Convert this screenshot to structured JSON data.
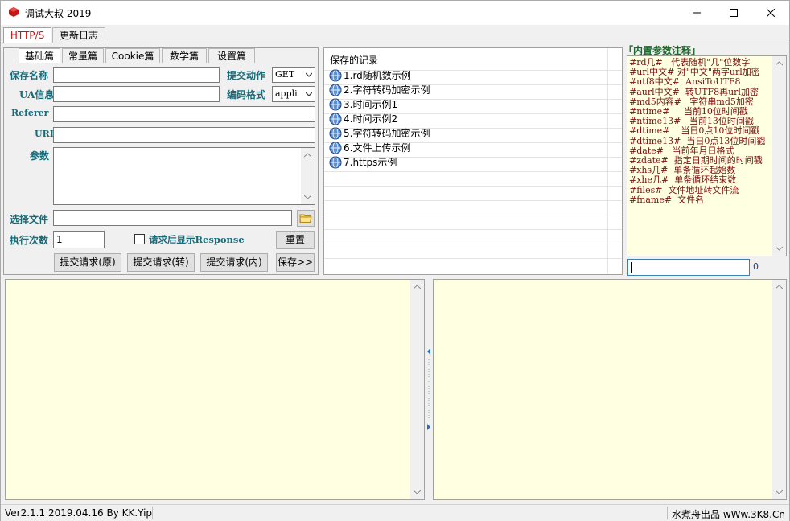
{
  "window": {
    "title": "调试大叔 2019"
  },
  "top_tabs": [
    {
      "label": "HTTP/S"
    },
    {
      "label": "更新日志"
    }
  ],
  "sub_tabs": [
    {
      "label": "基础篇"
    },
    {
      "label": "常量篇"
    },
    {
      "label": "Cookie篇"
    },
    {
      "label": "数学篇"
    },
    {
      "label": "设置篇"
    }
  ],
  "form": {
    "save_name_label": "保存名称",
    "ua_label": "UA信息",
    "referer_label": "Referer",
    "url_label": "URL",
    "params_label": "参数",
    "file_label": "选择文件",
    "count_label": "执行次数",
    "count_value": "1",
    "method_label": "提交动作",
    "method_value": "GET",
    "encoding_label": "编码格式",
    "encoding_value": "appli",
    "show_response_label": "请求后显示Response",
    "reset_button": "重置",
    "submit_raw": "提交请求(原)",
    "submit_convert": "提交请求(转)",
    "submit_inner": "提交请求(内)",
    "save_button": "保存>>"
  },
  "saved": {
    "header": "保存的记录",
    "items": [
      "1.rd随机数示例",
      "2.字符转码加密示例",
      "3.时间示例1",
      "4.时间示例2",
      "5.字符转码加密示例",
      "6.文件上传示例",
      "7.https示例"
    ]
  },
  "notes": {
    "title": "「内置参数注释」",
    "lines": [
      "#rd几#   代表随机\"几\"位数字",
      "#url中文# 对\"中文\"两字url加密",
      "#utf8中文#  AnsiToUTF8",
      "#aurl中文#  转UTF8再url加密",
      "#md5内容#   字符串md5加密",
      "#ntime#     当前10位时间戳",
      "#ntime13#   当前13位时间戳",
      "#dtime#    当日0点10位时间戳",
      "#dtime13#  当日0点13位时间戳",
      "#date#   当前年月日格式",
      "#zdate#  指定日期时间的时间戳",
      "#xhs几#  单条循环起始数",
      "#xhe几#  单条循环结束数",
      "#files#  文件地址转文件流",
      "#fname#  文件名"
    ],
    "counter": "0"
  },
  "status": {
    "left": "Ver2.1.1 2019.04.16 By KK.Yip",
    "right": "水煮舟出品 wWw.3K8.Cn"
  },
  "colors": {
    "label_teal": "#1a6b7a",
    "tab_active_red": "#d21010",
    "note_text": "#7a1010",
    "cream": "#ffffe1"
  }
}
